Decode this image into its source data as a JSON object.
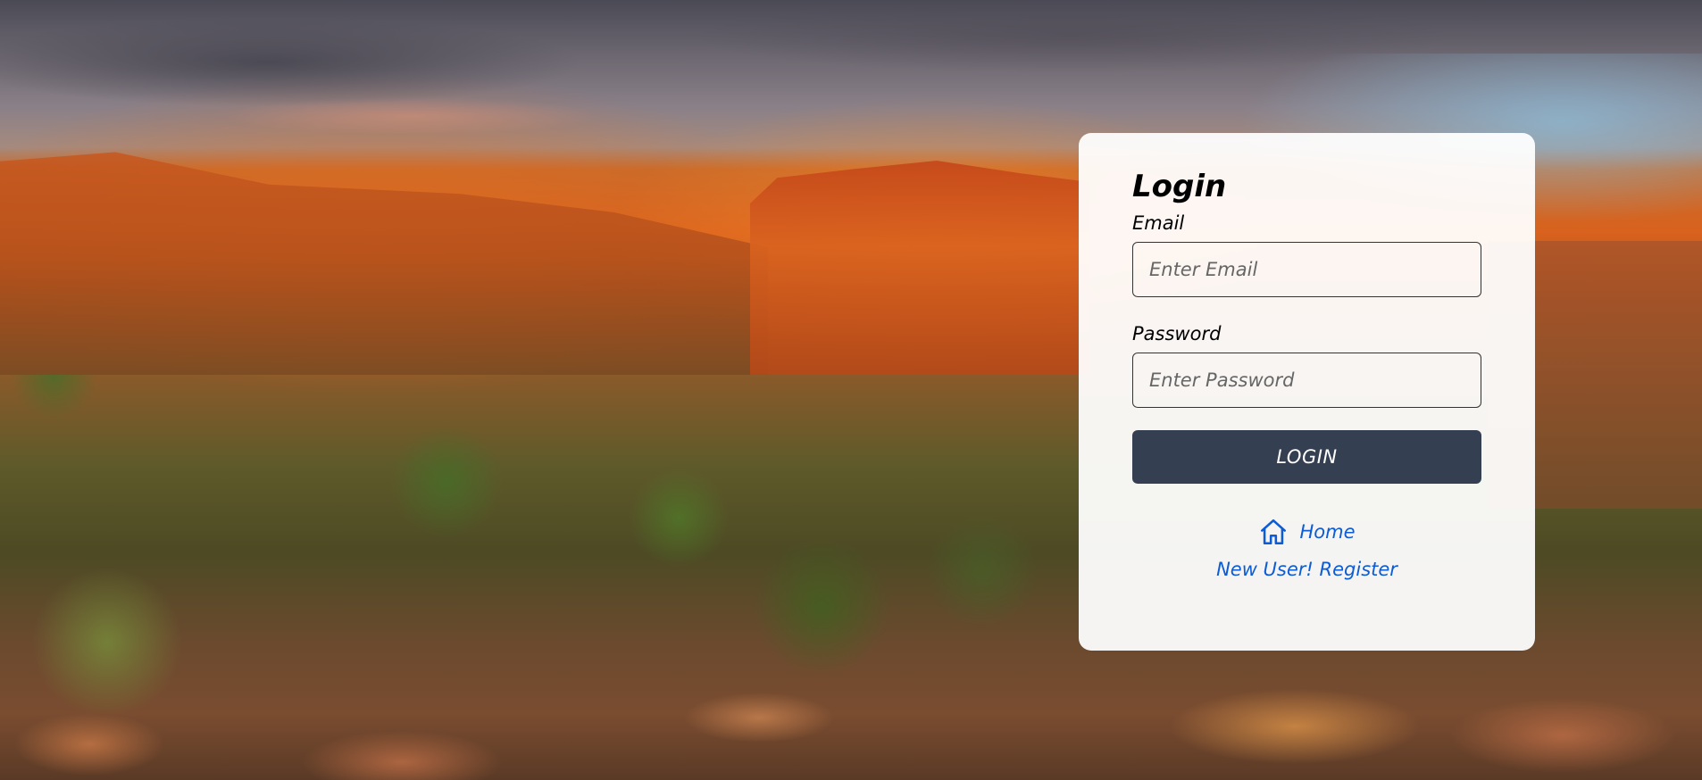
{
  "login": {
    "title": "Login",
    "email_label": "Email",
    "email_placeholder": "Enter Email",
    "email_value": "",
    "password_label": "Password",
    "password_placeholder": "Enter Password",
    "password_value": "",
    "submit_label": "LOGIN"
  },
  "links": {
    "home_label": "Home",
    "home_icon": "home-icon",
    "register_label": "New User! Register"
  },
  "colors": {
    "button_bg": "#343f52",
    "link": "#0b5cd5",
    "card_bg": "#ffffff"
  }
}
